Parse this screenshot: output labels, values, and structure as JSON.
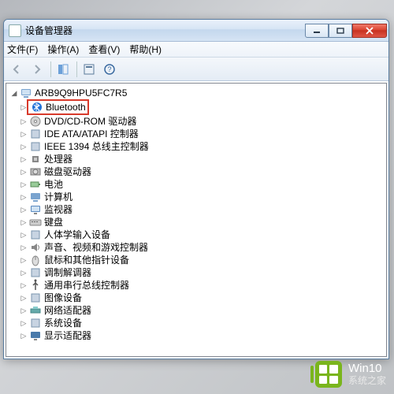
{
  "window": {
    "title": "设备管理器"
  },
  "menubar": {
    "file": "文件(F)",
    "action": "操作(A)",
    "view": "查看(V)",
    "help": "帮助(H)"
  },
  "tree": {
    "root": "ARB9Q9HPU5FC7R5",
    "items": [
      {
        "label": "Bluetooth",
        "icon": "bluetooth",
        "highlighted": true
      },
      {
        "label": "DVD/CD-ROM 驱动器",
        "icon": "disc"
      },
      {
        "label": "IDE ATA/ATAPI 控制器",
        "icon": "ide"
      },
      {
        "label": "IEEE 1394 总线主控制器",
        "icon": "ieee"
      },
      {
        "label": "处理器",
        "icon": "cpu"
      },
      {
        "label": "磁盘驱动器",
        "icon": "disk"
      },
      {
        "label": "电池",
        "icon": "battery"
      },
      {
        "label": "计算机",
        "icon": "computer"
      },
      {
        "label": "监视器",
        "icon": "monitor"
      },
      {
        "label": "键盘",
        "icon": "keyboard"
      },
      {
        "label": "人体学输入设备",
        "icon": "hid"
      },
      {
        "label": "声音、视频和游戏控制器",
        "icon": "sound"
      },
      {
        "label": "鼠标和其他指针设备",
        "icon": "mouse"
      },
      {
        "label": "调制解调器",
        "icon": "modem"
      },
      {
        "label": "通用串行总线控制器",
        "icon": "usb"
      },
      {
        "label": "图像设备",
        "icon": "image"
      },
      {
        "label": "网络适配器",
        "icon": "network"
      },
      {
        "label": "系统设备",
        "icon": "system"
      },
      {
        "label": "显示适配器",
        "icon": "display"
      }
    ]
  },
  "brand": {
    "line1": "Win10",
    "line2": "系统之家"
  }
}
